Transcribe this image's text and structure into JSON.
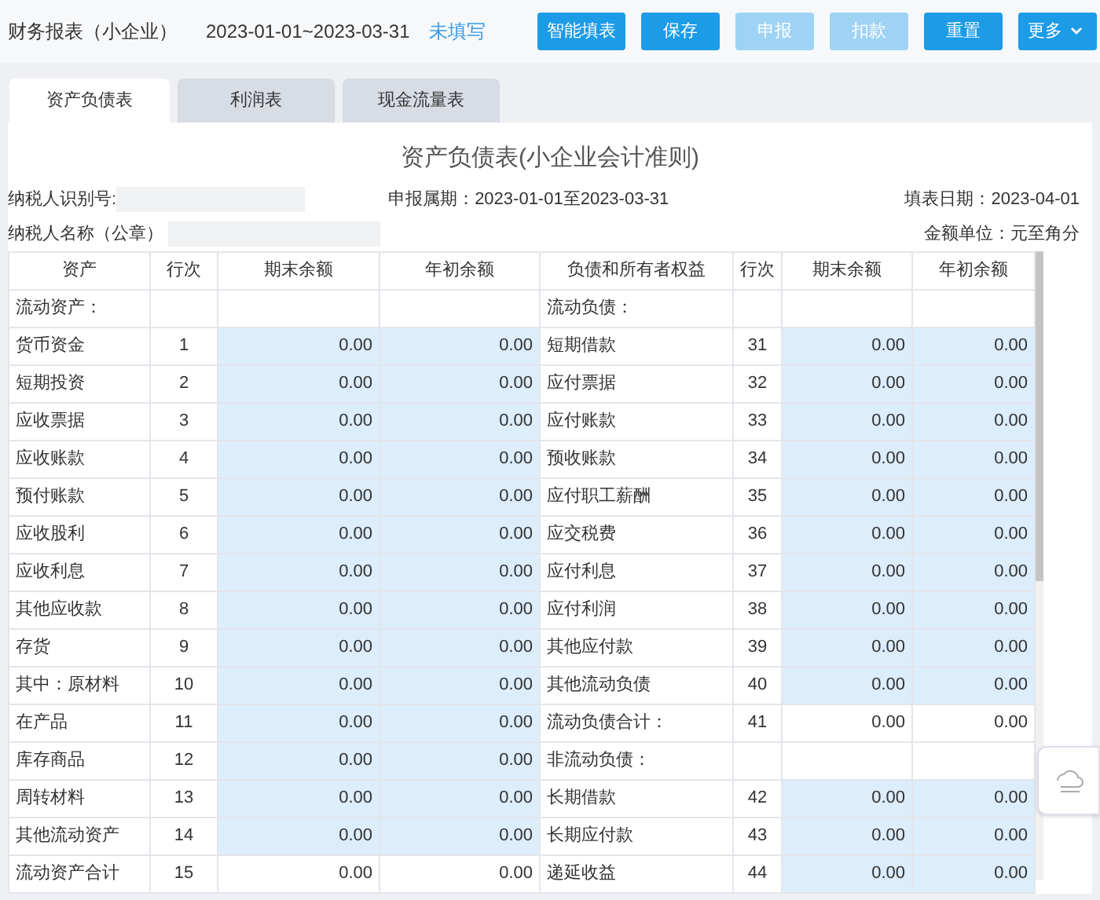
{
  "header": {
    "title": "财务报表（小企业）",
    "period": "2023-01-01~2023-03-31",
    "status": "未填写"
  },
  "buttons": [
    {
      "label": "智能填表",
      "disabled": false
    },
    {
      "label": "保存",
      "disabled": false
    },
    {
      "label": "申报",
      "disabled": true
    },
    {
      "label": "扣款",
      "disabled": true
    },
    {
      "label": "重置",
      "disabled": false
    },
    {
      "label": "更多",
      "disabled": false,
      "kind": "dropdown"
    }
  ],
  "tabs": [
    {
      "label": "资产负债表",
      "selected": true
    },
    {
      "label": "利润表",
      "selected": false
    },
    {
      "label": "现金流量表",
      "selected": false
    }
  ],
  "report": {
    "title": "资产负债表(小企业会计准则)",
    "taxpayer_id_label": "纳税人识别号:",
    "period_label": "申报属期：2023-01-01至2023-03-31",
    "fill_date_label": "填表日期：2023-04-01",
    "taxpayer_name_label": "纳税人名称（公章）",
    "unit_label": "金额单位：元至角分"
  },
  "table": {
    "columns": [
      "资产",
      "行次",
      "期末余额",
      "年初余额",
      "负债和所有者权益",
      "行次",
      "期末余额",
      "年初余额"
    ],
    "rows": [
      {
        "left": {
          "kind": "heading",
          "item": "流动资产："
        },
        "right": {
          "kind": "heading",
          "item": "流动负债："
        }
      },
      {
        "left": {
          "kind": "input",
          "item": "货币资金",
          "line": "1",
          "end": "0.00",
          "begin": "0.00"
        },
        "right": {
          "kind": "input",
          "item": "短期借款",
          "line": "31",
          "end": "0.00",
          "begin": "0.00"
        }
      },
      {
        "left": {
          "kind": "input",
          "item": "短期投资",
          "line": "2",
          "end": "0.00",
          "begin": "0.00"
        },
        "right": {
          "kind": "input",
          "item": "应付票据",
          "line": "32",
          "end": "0.00",
          "begin": "0.00"
        }
      },
      {
        "left": {
          "kind": "input",
          "item": "应收票据",
          "line": "3",
          "end": "0.00",
          "begin": "0.00"
        },
        "right": {
          "kind": "input",
          "item": "应付账款",
          "line": "33",
          "end": "0.00",
          "begin": "0.00"
        }
      },
      {
        "left": {
          "kind": "input",
          "item": "应收账款",
          "line": "4",
          "end": "0.00",
          "begin": "0.00"
        },
        "right": {
          "kind": "input",
          "item": "预收账款",
          "line": "34",
          "end": "0.00",
          "begin": "0.00"
        }
      },
      {
        "left": {
          "kind": "input",
          "item": "预付账款",
          "line": "5",
          "end": "0.00",
          "begin": "0.00"
        },
        "right": {
          "kind": "input",
          "item": "应付职工薪酬",
          "line": "35",
          "end": "0.00",
          "begin": "0.00"
        }
      },
      {
        "left": {
          "kind": "input",
          "item": "应收股利",
          "line": "6",
          "end": "0.00",
          "begin": "0.00"
        },
        "right": {
          "kind": "input",
          "item": "应交税费",
          "line": "36",
          "end": "0.00",
          "begin": "0.00"
        }
      },
      {
        "left": {
          "kind": "input",
          "item": "应收利息",
          "line": "7",
          "end": "0.00",
          "begin": "0.00"
        },
        "right": {
          "kind": "input",
          "item": "应付利息",
          "line": "37",
          "end": "0.00",
          "begin": "0.00"
        }
      },
      {
        "left": {
          "kind": "input",
          "item": "其他应收款",
          "line": "8",
          "end": "0.00",
          "begin": "0.00"
        },
        "right": {
          "kind": "input",
          "item": "应付利润",
          "line": "38",
          "end": "0.00",
          "begin": "0.00"
        }
      },
      {
        "left": {
          "kind": "input",
          "item": "存货",
          "line": "9",
          "end": "0.00",
          "begin": "0.00"
        },
        "right": {
          "kind": "input",
          "item": "其他应付款",
          "line": "39",
          "end": "0.00",
          "begin": "0.00"
        }
      },
      {
        "left": {
          "kind": "input",
          "item": "其中：原材料",
          "line": "10",
          "end": "0.00",
          "begin": "0.00"
        },
        "right": {
          "kind": "input",
          "item": "其他流动负债",
          "line": "40",
          "end": "0.00",
          "begin": "0.00"
        }
      },
      {
        "left": {
          "kind": "input",
          "item": "在产品",
          "line": "11",
          "end": "0.00",
          "begin": "0.00"
        },
        "right": {
          "kind": "total",
          "item": "流动负债合计：",
          "line": "41",
          "end": "0.00",
          "begin": "0.00"
        }
      },
      {
        "left": {
          "kind": "input",
          "item": "库存商品",
          "line": "12",
          "end": "0.00",
          "begin": "0.00"
        },
        "right": {
          "kind": "heading",
          "item": "非流动负债："
        }
      },
      {
        "left": {
          "kind": "input",
          "item": "周转材料",
          "line": "13",
          "end": "0.00",
          "begin": "0.00"
        },
        "right": {
          "kind": "input",
          "item": "长期借款",
          "line": "42",
          "end": "0.00",
          "begin": "0.00"
        }
      },
      {
        "left": {
          "kind": "input",
          "item": "其他流动资产",
          "line": "14",
          "end": "0.00",
          "begin": "0.00"
        },
        "right": {
          "kind": "input",
          "item": "长期应付款",
          "line": "43",
          "end": "0.00",
          "begin": "0.00"
        }
      },
      {
        "left": {
          "kind": "total",
          "item": "流动资产合计",
          "line": "15",
          "end": "0.00",
          "begin": "0.00"
        },
        "right": {
          "kind": "input",
          "item": "递延收益",
          "line": "44",
          "end": "0.00",
          "begin": "0.00"
        }
      }
    ]
  }
}
